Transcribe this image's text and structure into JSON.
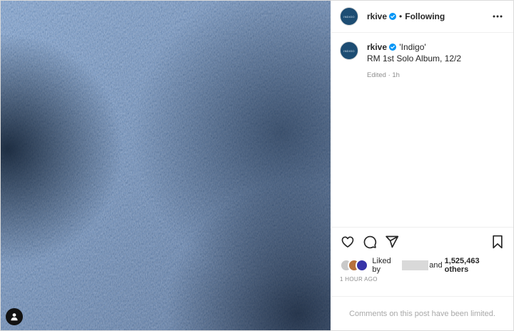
{
  "post": {
    "username": "rkive",
    "follow_status": "Following",
    "separator": "•",
    "avatar_label": "INDIGO",
    "caption": {
      "title": "'Indigo'",
      "body": "RM 1st Solo Album, 12/2",
      "edited": "Edited",
      "age": "1h"
    },
    "likes": {
      "prefix": "Liked by",
      "middle": "and",
      "count": "1,525,463 others"
    },
    "timestamp": "1 HOUR AGO",
    "comments_notice": "Comments on this post have been limited."
  },
  "colors": {
    "verified_blue": "#0095f6",
    "denim_base": "#2c4466",
    "meta_gray": "#8e8e8e"
  },
  "icons": [
    "heart-icon",
    "comment-icon",
    "share-icon",
    "bookmark-icon",
    "more-icon",
    "verified-icon",
    "user-tag-icon"
  ]
}
